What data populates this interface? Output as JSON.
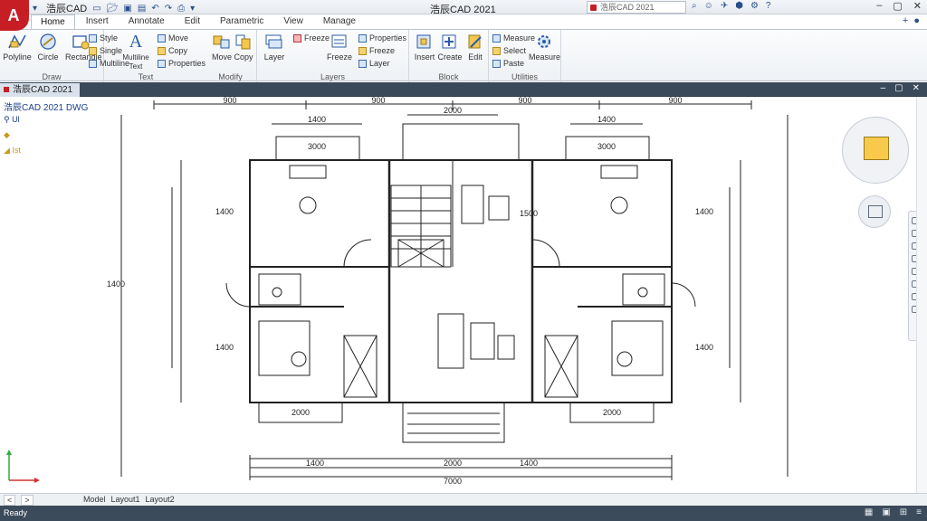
{
  "app": {
    "logo": "A",
    "quick_title": "浩辰CAD",
    "window_title": "浩辰CAD 2021",
    "search_placeholder": "浩辰CAD 2021"
  },
  "ribbon_tabs": [
    "Home",
    "Insert",
    "Annotate",
    "Edit",
    "Parametric",
    "View",
    "Manage"
  ],
  "ribbon": {
    "draw_panel": {
      "title": "Draw",
      "buttons": [
        "Polyline",
        "Circle",
        "Rectangle"
      ]
    },
    "text_panel": {
      "title": "Text",
      "buttons": [
        "Multiline",
        "Style",
        "Single"
      ],
      "big": "Multiline Text"
    },
    "modify_panel": {
      "title": "Modify",
      "buttons": [
        "Move",
        "Copy"
      ]
    },
    "layers_panel": {
      "title": "Layers",
      "buttons": [
        "Layer",
        "Freeze",
        "Properties"
      ]
    },
    "block_panel": {
      "title": "Block",
      "buttons": [
        "Insert",
        "Create",
        "Edit"
      ]
    },
    "utilities_panel": {
      "title": "Utilities",
      "buttons": [
        "Measure",
        "Select",
        "Paste"
      ],
      "big": "Measure"
    }
  },
  "document": {
    "tab_label": "浩辰CAD 2021",
    "viewport_label": "浩辰CAD 2021 DWG"
  },
  "plan": {
    "top_dims": [
      "900",
      "900",
      "900",
      "900"
    ],
    "dims_row2": [
      "1400",
      "2000",
      "1400"
    ],
    "room_dims": [
      "3000",
      "3000"
    ],
    "side_dims_left": [
      "1400",
      "1400"
    ],
    "side_dims_right": [
      "1400",
      "1400"
    ],
    "middle_label": "1500",
    "bottom_room_dims": [
      "2000",
      "2000"
    ],
    "bottom_dims": [
      "1400",
      "2000",
      "1400"
    ],
    "bottom_total": "7000",
    "left_total": "1400"
  },
  "layout": {
    "tabs": [
      "Model",
      "Layout1",
      "Layout2"
    ],
    "nav": [
      "<",
      ">"
    ]
  },
  "status": {
    "text": "Ready",
    "icons": [
      "grid-icon",
      "snap-icon",
      "ortho-icon",
      "settings-icon"
    ]
  }
}
